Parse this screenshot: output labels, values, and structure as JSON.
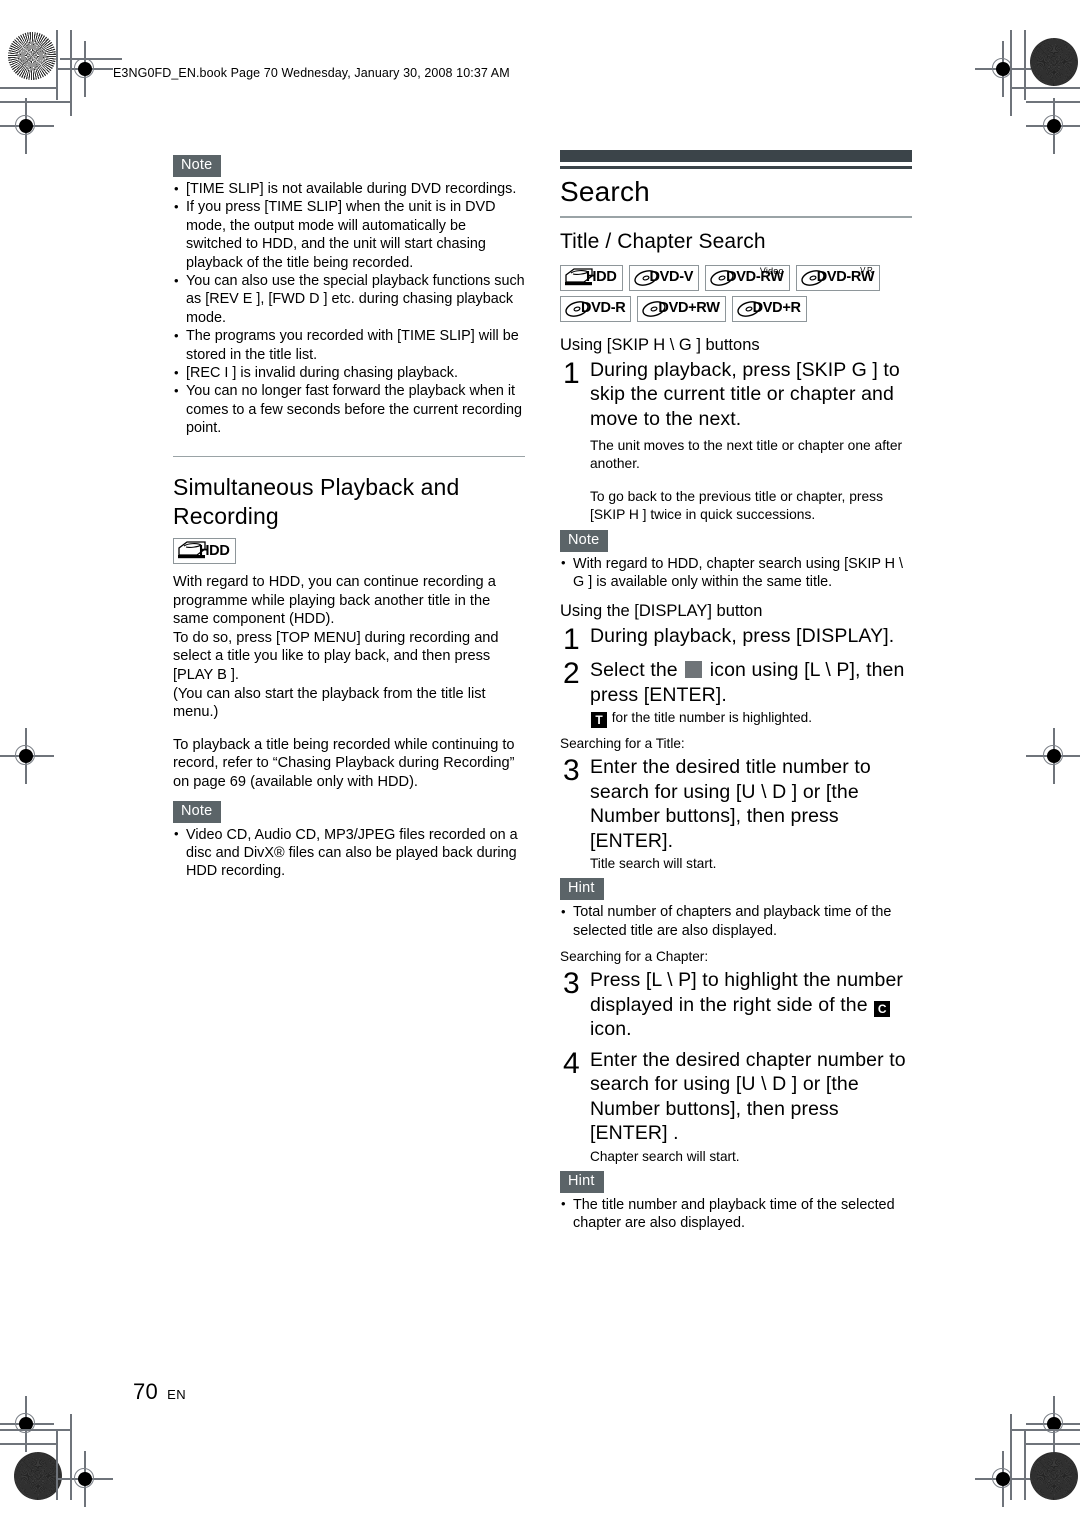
{
  "file_header": "E3NG0FD_EN.book  Page 70  Wednesday, January 30, 2008  10:37 AM",
  "footer": {
    "page_number": "70",
    "language": "EN"
  },
  "left_column": {
    "note1": {
      "label": "Note",
      "items": [
        "[TIME SLIP] is not available during DVD recordings.",
        "If you press [TIME SLIP] when the unit is in DVD mode, the output mode will automatically be switched to HDD, and the unit will start chasing playback of the title being recorded.",
        "You can also use the special playback functions such as [REV E  ], [FWD D  ] etc. during chasing playback mode.",
        "The programs you recorded with [TIME SLIP] will be stored in the title list.",
        "[REC I  ] is invalid during chasing playback.",
        "You can no longer fast forward the playback when it comes to a few seconds before the current recording point."
      ]
    },
    "heading": "Simultaneous Playback and Recording",
    "media_badge": {
      "icon": "hdd-icon",
      "label": "HDD"
    },
    "paragraphs": [
      "With regard to HDD, you can continue recording a programme while playing back another title in the same component (HDD).",
      "To do so, press [TOP MENU] during recording and select a title you like to play back, and then press [PLAY B ].",
      "(You can also start the playback from the title list menu.)",
      "To playback a title being recorded while continuing to record, refer to “Chasing Playback during Recording” on page 69 (available only with HDD)."
    ],
    "note2": {
      "label": "Note",
      "items": [
        "Video CD, Audio CD, MP3/JPEG files recorded on a disc and DivX® files can also be played back during HDD recording."
      ]
    }
  },
  "right_column": {
    "section_title": "Search",
    "subsection_title": "Title / Chapter Search",
    "media_badges": [
      {
        "icon": "hdd-icon",
        "label": "HDD",
        "sup": ""
      },
      {
        "icon": "disc-icon",
        "label": "DVD-V",
        "sup": ""
      },
      {
        "icon": "disc-icon",
        "label": "DVD-RW",
        "sup": "Video"
      },
      {
        "icon": "disc-icon",
        "label": "DVD-RW",
        "sup": "VR"
      },
      {
        "icon": "disc-icon",
        "label": "DVD-R",
        "sup": ""
      },
      {
        "icon": "disc-icon",
        "label": "DVD+RW",
        "sup": ""
      },
      {
        "icon": "disc-icon",
        "label": "DVD+R",
        "sup": ""
      }
    ],
    "skip_section": {
      "heading": "Using [SKIP H  \\ G  ] buttons",
      "step1_num": "1",
      "step1_text": "During playback, press [SKIP G  ] to skip the current title or chapter and move to the next.",
      "para1": "The unit moves to the next title or chapter one after another.",
      "para2": "To go back to the previous title or chapter, press [SKIP H  ] twice in quick successions.",
      "note": {
        "label": "Note",
        "items": [
          "With regard to HDD, chapter search using [SKIP H   \\ G  ] is available only within the same title."
        ]
      }
    },
    "display_section": {
      "heading": "Using the [DISPLAY] button",
      "step1_num": "1",
      "step1_text": "During playback, press [DISPLAY].",
      "step2_num": "2",
      "step2_text_a": "Select the",
      "step2_icon": "gray-square-icon",
      "step2_text_b": "icon using [L \\ P], then press [ENTER].",
      "step2_sub_icon": "T",
      "step2_sub_text": "for the title number is highlighted.",
      "title_label": "Searching for a Title:",
      "step3_num": "3",
      "step3_text": "Enter the desired title number to search for using [U  \\ D ] or [the Number buttons], then press [ENTER].",
      "step3_sub": "Title search will start.",
      "hint1": {
        "label": "Hint",
        "items": [
          "Total number of chapters and playback time of the selected title are also displayed."
        ]
      },
      "chapter_label": "Searching for a Chapter:",
      "step3b_num": "3",
      "step3b_text_a": "Press [L \\ P] to highlight the number displayed in the right side of the",
      "step3b_icon": "C",
      "step3b_text_b": "icon.",
      "step4_num": "4",
      "step4_text": "Enter the desired chapter number to search for using [U  \\ D ] or [the Number buttons], then press [ENTER] .",
      "step4_sub": "Chapter search will start.",
      "hint2": {
        "label": "Hint",
        "items": [
          "The title number and playback time of the selected chapter are also displayed."
        ]
      }
    }
  },
  "colors": {
    "chip_bg": "#5b6468",
    "rule_dark": "#3b4449",
    "rule_light": "#9aa3a6",
    "icon_gray": "#6f7478"
  }
}
